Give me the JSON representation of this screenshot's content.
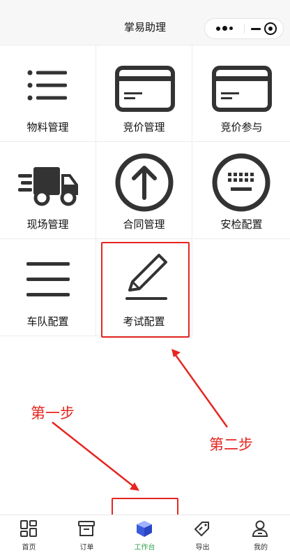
{
  "nav": {
    "title": "掌易助理"
  },
  "grid": {
    "items": [
      {
        "label": "物料管理",
        "icon": "list-icon"
      },
      {
        "label": "竞价管理",
        "icon": "card-icon"
      },
      {
        "label": "竞价参与",
        "icon": "card-icon"
      },
      {
        "label": "现场管理",
        "icon": "truck-icon"
      },
      {
        "label": "合同管理",
        "icon": "arrow-up-circle-icon"
      },
      {
        "label": "安检配置",
        "icon": "keyboard-icon"
      },
      {
        "label": "车队配置",
        "icon": "menu-icon"
      },
      {
        "label": "考试配置",
        "icon": "pencil-icon"
      }
    ]
  },
  "annotations": {
    "step1": "第一步",
    "step2": "第二步",
    "color": "#e52620"
  },
  "tabbar": {
    "active_color": "#2fa34a",
    "items": [
      {
        "label": "首页",
        "icon": "grid-icon"
      },
      {
        "label": "订单",
        "icon": "box-icon"
      },
      {
        "label": "工作台",
        "icon": "cube-icon"
      },
      {
        "label": "导出",
        "icon": "tag-icon"
      },
      {
        "label": "我的",
        "icon": "user-icon"
      }
    ]
  }
}
